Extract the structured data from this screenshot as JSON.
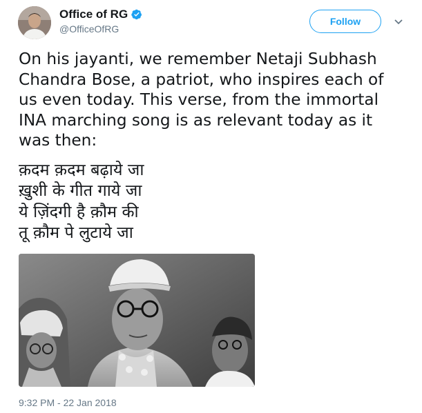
{
  "author": {
    "display_name": "Office of RG",
    "handle": "@OfficeOfRG",
    "verified": true,
    "avatar_icon": "profile-photo"
  },
  "follow_label": "Follow",
  "tweet": {
    "text": "On his jayanti, we remember Netaji Subhash\nChandra Bose, a patriot, who inspires each of\nus even today. This verse, from the immortal\nINA marching song is as relevant today as it\nwas then:",
    "verse": [
      "क़दम क़दम बढ़ाये जा",
      "ख़ुशी के गीत गाये जा",
      "ये ज़िंदगी है क़ौम की",
      "तू क़ौम पे लुटाये जा"
    ]
  },
  "timestamp": "9:32 PM - 22 Jan 2018",
  "colors": {
    "accent": "#1da1f2",
    "secondary_text": "#657786",
    "primary_text": "#14171a"
  }
}
